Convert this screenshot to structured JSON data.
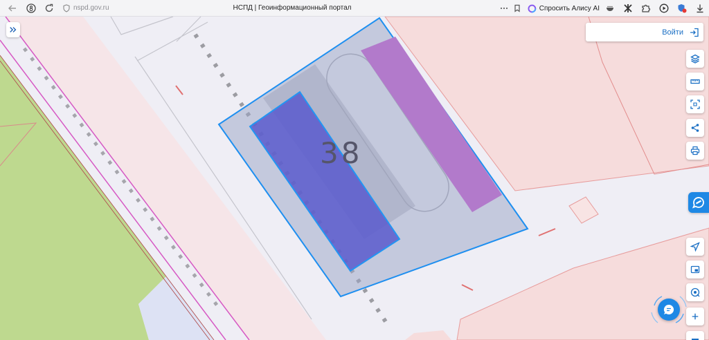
{
  "browser": {
    "url": "nspd.gov.ru",
    "tab_title": "НСПД | Геоинформационный портал",
    "alice_label": "Спросить Алису AI",
    "toolbar_icons": [
      "back-icon",
      "protect-icon",
      "reload-icon",
      "site-info-icon",
      "more-icon",
      "bookmark-icon",
      "alice-icon",
      "extension-bowl-icon",
      "extension-cross-icon",
      "extensions-icon",
      "media-icon",
      "shield-extension-icon",
      "downloads-icon"
    ]
  },
  "map": {
    "parcel_number": "38",
    "login_label": "Войти",
    "left_panel_icon": "expand-panel-icon",
    "tools_top_icons": [
      "layers-icon",
      "ruler-icon",
      "select-area-icon",
      "share-icon",
      "print-icon"
    ],
    "side_widget_icon": "chat-logo-icon",
    "tools_bottom_icons": [
      "navigate-icon",
      "display-mode-icon",
      "geolocation-icon",
      "zoom-in-icon",
      "zoom-out-icon"
    ],
    "chat_icon": "chat-icon"
  },
  "colors": {
    "accent": "#1e88e5",
    "selected_parcel_stroke": "#1e8ff0",
    "selected_parcel_fill": "#9aa3c6",
    "building_fill": "#5a5acd",
    "purple_zone_fill": "#b27acb",
    "pink_zone_fill": "#f6dcdc",
    "green_zone_fill": "#bed98f"
  }
}
